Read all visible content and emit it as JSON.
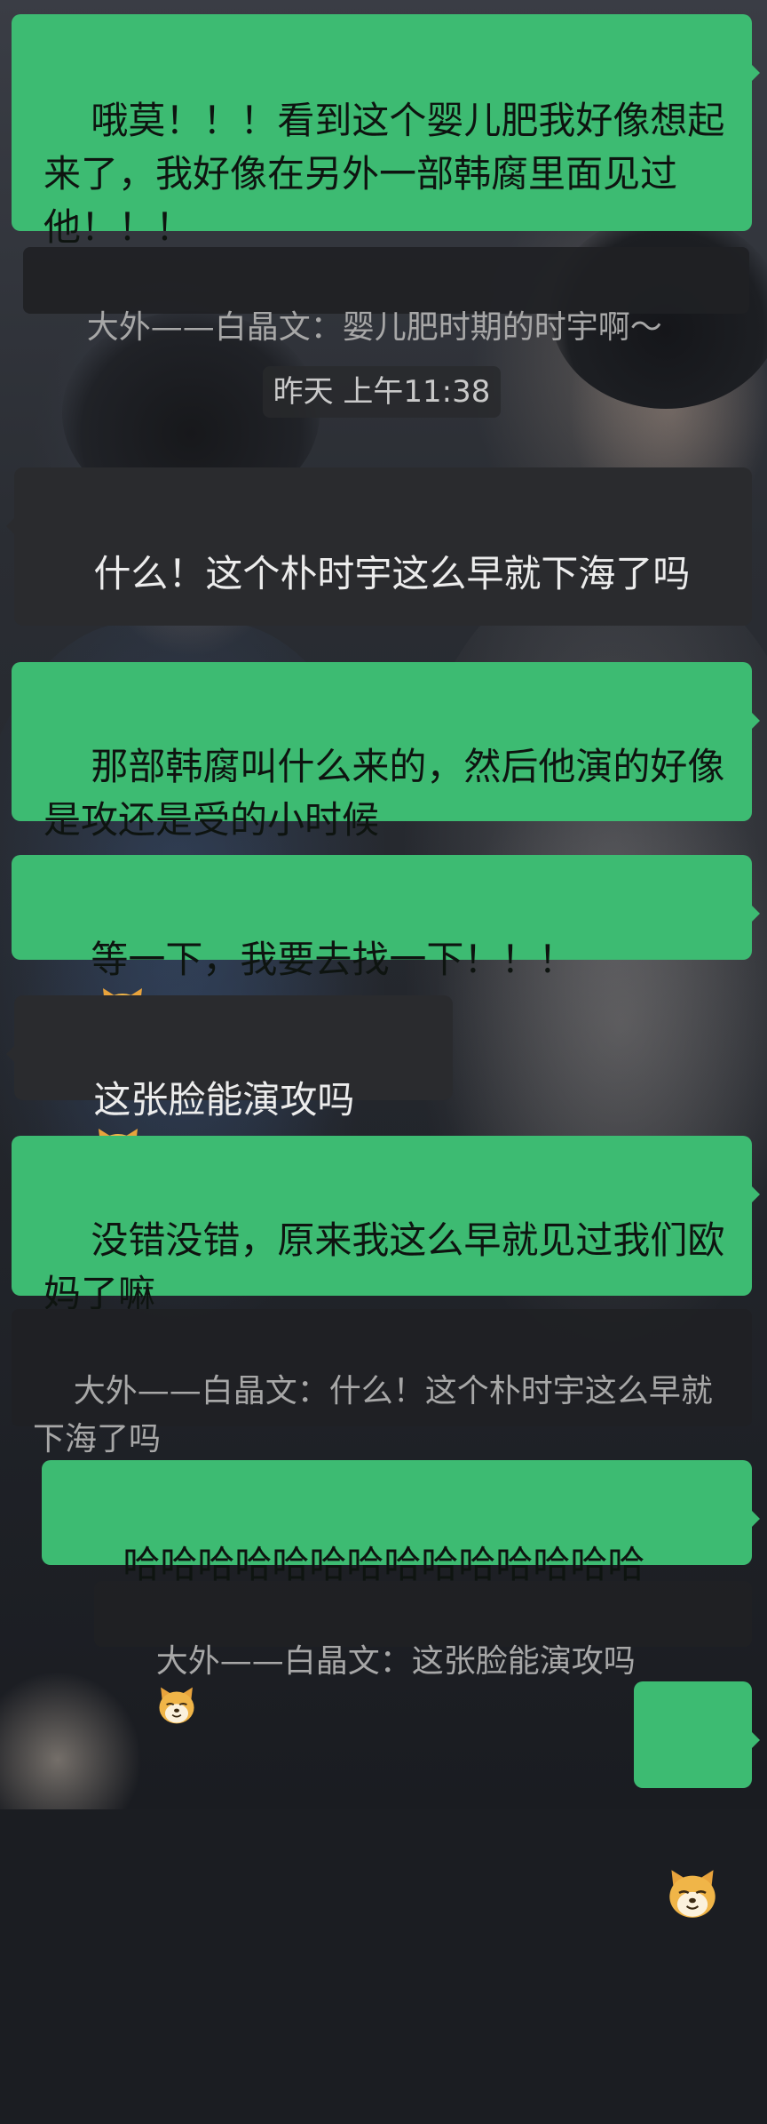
{
  "messages": [
    {
      "side": "out",
      "text": "哦莫！！！看到这个婴儿肥我好像想起来了，我好像在另外一部韩腐里面见过他！！！"
    },
    {
      "type": "quote",
      "text": "大外——白晶文：婴儿肥时期的时宇啊～"
    },
    {
      "type": "timestamp",
      "text": "昨天 上午11:38"
    },
    {
      "side": "in",
      "text": "什么！这个朴时宇这么早就下海了吗"
    },
    {
      "side": "out",
      "text": "那部韩腐叫什么来的，然后他演的好像是攻还是受的小时候"
    },
    {
      "side": "out",
      "text": "等一下，我要去找一下！！！",
      "emoji": "doge-emoji"
    },
    {
      "side": "in",
      "text": "这张脸能演攻吗",
      "emoji": "doge-emoji"
    },
    {
      "side": "out",
      "text": "没错没错，原来我这么早就见过我们欧妈了嘛"
    },
    {
      "type": "quote",
      "text": "大外——白晶文：什么！这个朴时宇这么早就下海了吗"
    },
    {
      "side": "out",
      "text": "哈哈哈哈哈哈哈哈哈哈哈哈哈哈"
    },
    {
      "type": "quote",
      "text": "大外——白晶文：这张脸能演攻吗",
      "emoji": "doge-emoji"
    },
    {
      "side": "out",
      "text": "",
      "emoji": "doge-emoji"
    }
  ],
  "colors": {
    "outgoing_bubble": "#3dbb72",
    "incoming_bubble": "#2a2b2e",
    "quote_background": "#202124",
    "quote_text": "#a7a7a7",
    "timestamp_text": "#c9c9c9"
  }
}
